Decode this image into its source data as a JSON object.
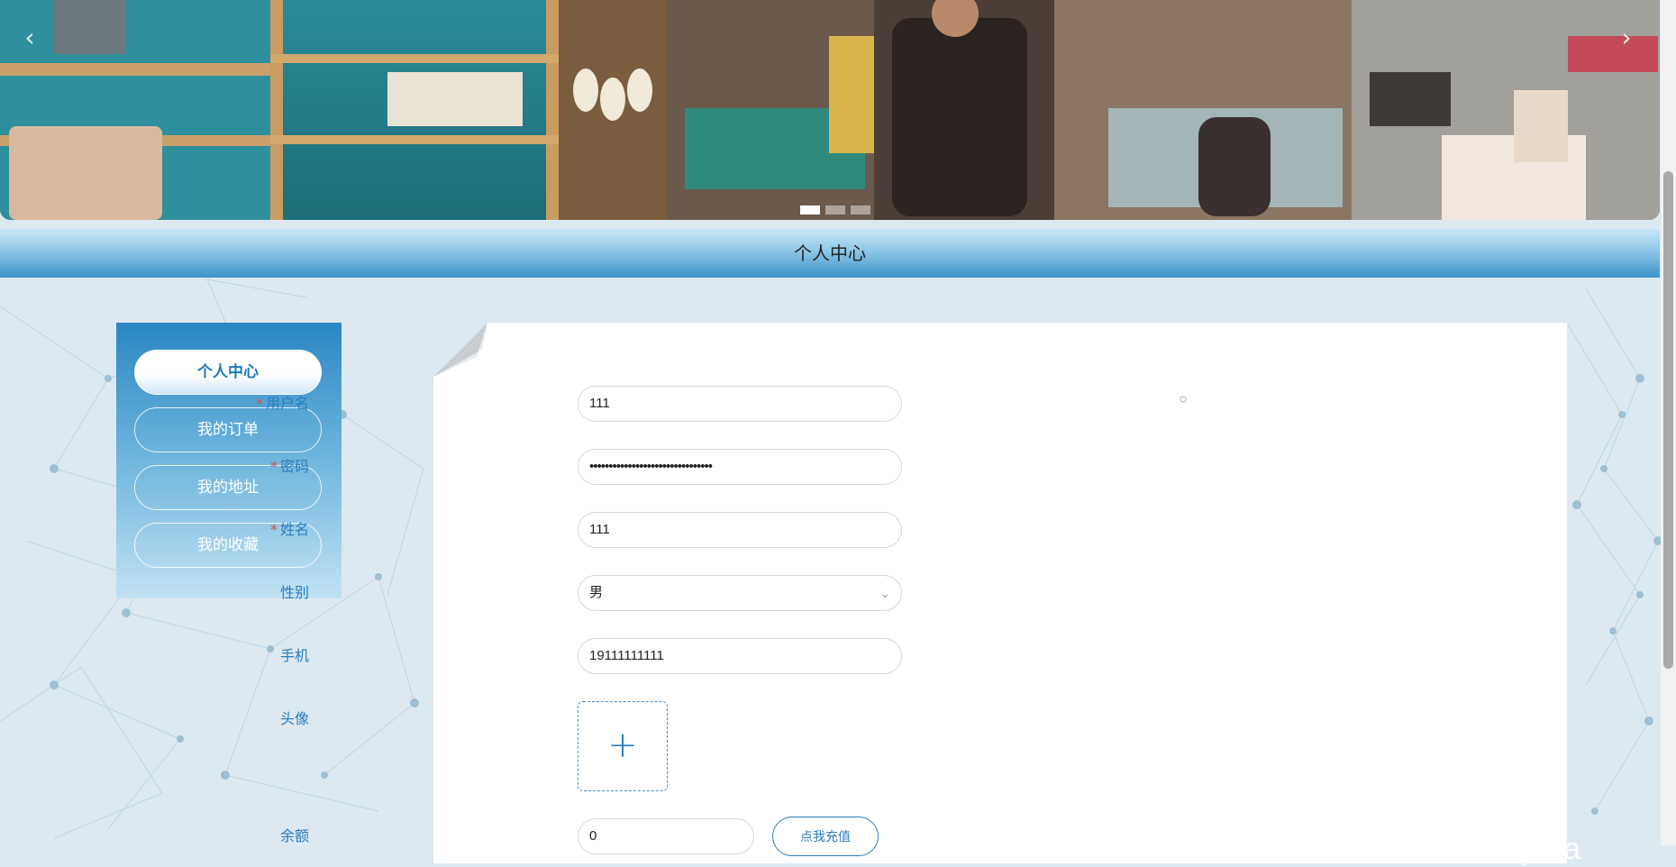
{
  "carousel": {
    "prev_label": "‹",
    "next_label": "›",
    "indicator_count": 3,
    "active_indicator": 0
  },
  "page": {
    "title": "个人中心"
  },
  "sidebar": {
    "items": [
      {
        "label": "个人中心",
        "active": true
      },
      {
        "label": "我的订单",
        "active": false
      },
      {
        "label": "我的地址",
        "active": false
      },
      {
        "label": "我的收藏",
        "active": false
      }
    ]
  },
  "form": {
    "username": {
      "label": "用户名",
      "required": true,
      "value": "111"
    },
    "password": {
      "label": "密码",
      "required": true,
      "value": "••••••••••••••••••••••••••••••••"
    },
    "name": {
      "label": "姓名",
      "required": true,
      "value": "111"
    },
    "gender": {
      "label": "性别",
      "required": false,
      "value": "男"
    },
    "phone": {
      "label": "手机",
      "required": false,
      "value": "19111111111"
    },
    "avatar": {
      "label": "头像",
      "upload_icon": "+"
    },
    "balance": {
      "label": "余额",
      "value": "0",
      "charge_label": "点我充值"
    }
  },
  "watermark": "CSDN @shaoweijava",
  "colors": {
    "accent": "#2a7cba",
    "required": "#e04a4a",
    "title_bar": "#3a93c8"
  }
}
